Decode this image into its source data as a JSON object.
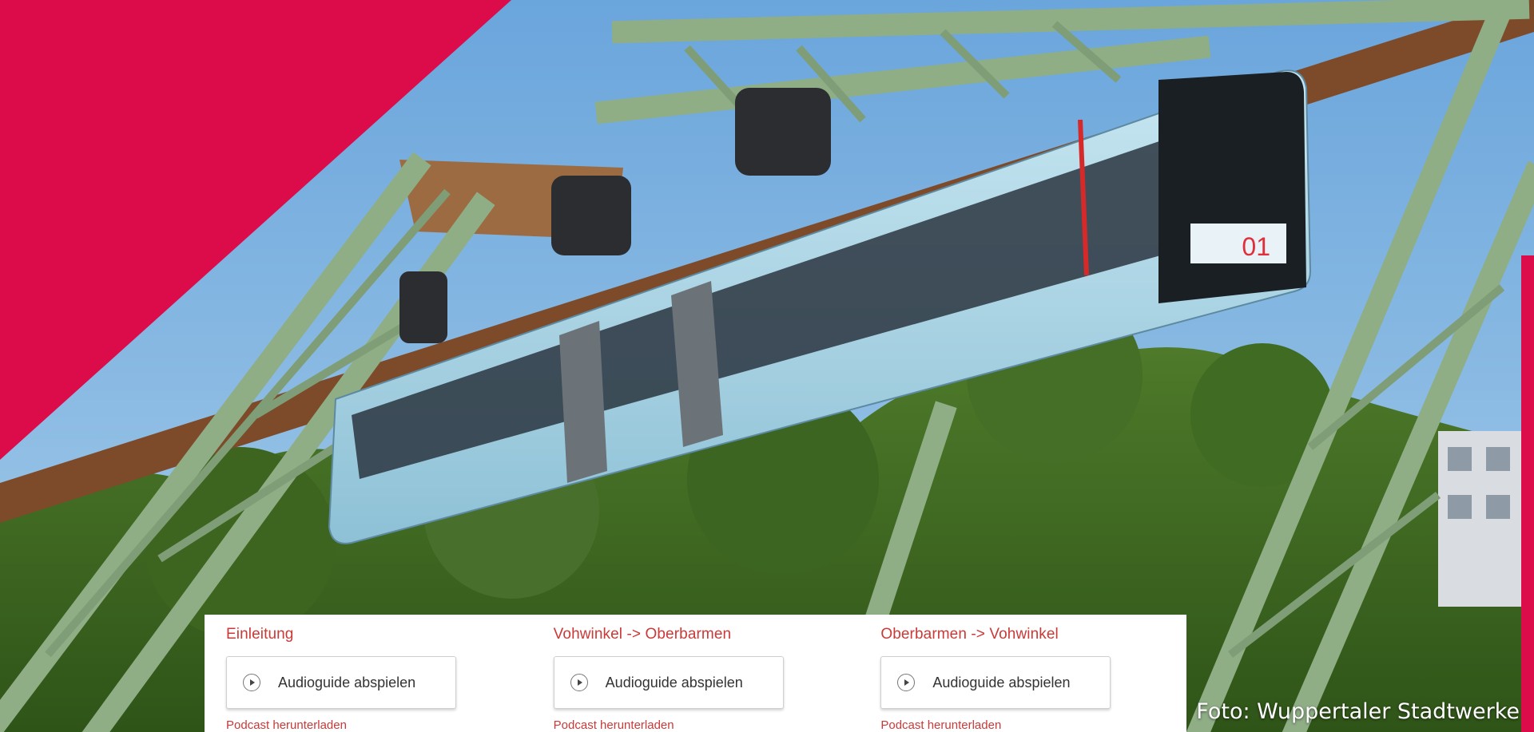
{
  "hero": {
    "image_description": "suspension-railway-photo",
    "car_number": "01",
    "credit": "Foto: Wuppertaler Stadtwerke"
  },
  "colors": {
    "accent_red": "#dc0b49",
    "link_red": "#c93a38"
  },
  "audio_sections": [
    {
      "title": "Einleitung",
      "button_label": "Audioguide abspielen",
      "podcast_label": "Podcast herunterladen"
    },
    {
      "title": "Vohwinkel -> Oberbarmen",
      "button_label": "Audioguide abspielen",
      "podcast_label": "Podcast herunterladen"
    },
    {
      "title": "Oberbarmen -> Vohwinkel",
      "button_label": "Audioguide abspielen",
      "podcast_label": "Podcast herunterladen"
    }
  ],
  "icons": {
    "play": "play-icon"
  }
}
